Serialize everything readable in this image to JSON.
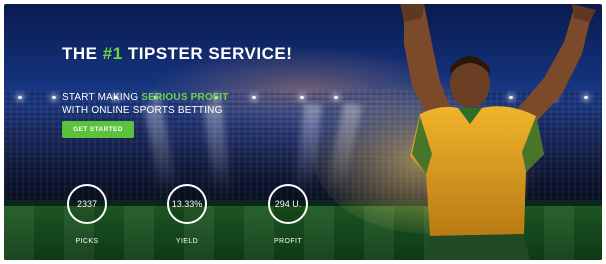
{
  "hero": {
    "headline_prefix": "THE ",
    "headline_accent": "#1",
    "headline_suffix": " TIPSTER SERVICE!",
    "sub_prefix": "START MAKING ",
    "sub_accent": "SERIOUS PROFIT",
    "sub_line2": "WITH ONLINE SPORTS BETTING",
    "cta_label": "GET STARTED"
  },
  "stats": [
    {
      "value": "2337",
      "label": "PICKS"
    },
    {
      "value": "13.33%",
      "label": "YIELD"
    },
    {
      "value": "294 U.",
      "label": "PROFIT"
    }
  ],
  "colors": {
    "accent": "#6fd34a",
    "button": "#5cc23d",
    "jersey": "#e0a623"
  }
}
